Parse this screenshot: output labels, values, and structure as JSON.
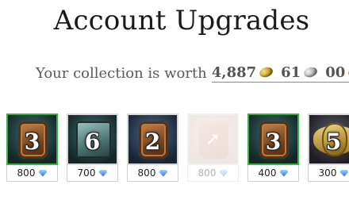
{
  "header": {
    "title": "Account Upgrades"
  },
  "collection": {
    "label": "Your collection is worth",
    "gold": "4,887",
    "silver": "61",
    "copper": "00",
    "coin_icons": [
      "gold-coin-icon",
      "silver-coin-icon",
      "copper-coin-icon"
    ]
  },
  "upgrades": [
    {
      "number": "3",
      "price": "800",
      "currency_icon": "gem-icon",
      "owned": true
    },
    {
      "number": "6",
      "price": "700",
      "currency_icon": "gem-icon",
      "owned": false
    },
    {
      "number": "2",
      "price": "800",
      "currency_icon": "gem-icon",
      "owned": false
    },
    {
      "number": "",
      "price": "800",
      "currency_icon": "gem-icon",
      "owned": false,
      "disabled": true
    },
    {
      "number": "3",
      "price": "400",
      "currency_icon": "gem-icon",
      "owned": true
    },
    {
      "number": "5",
      "price": "300",
      "currency_icon": "gem-icon",
      "owned": false
    }
  ],
  "colors": {
    "owned_border": "#3cb043",
    "gem": "#2c6fd6"
  }
}
